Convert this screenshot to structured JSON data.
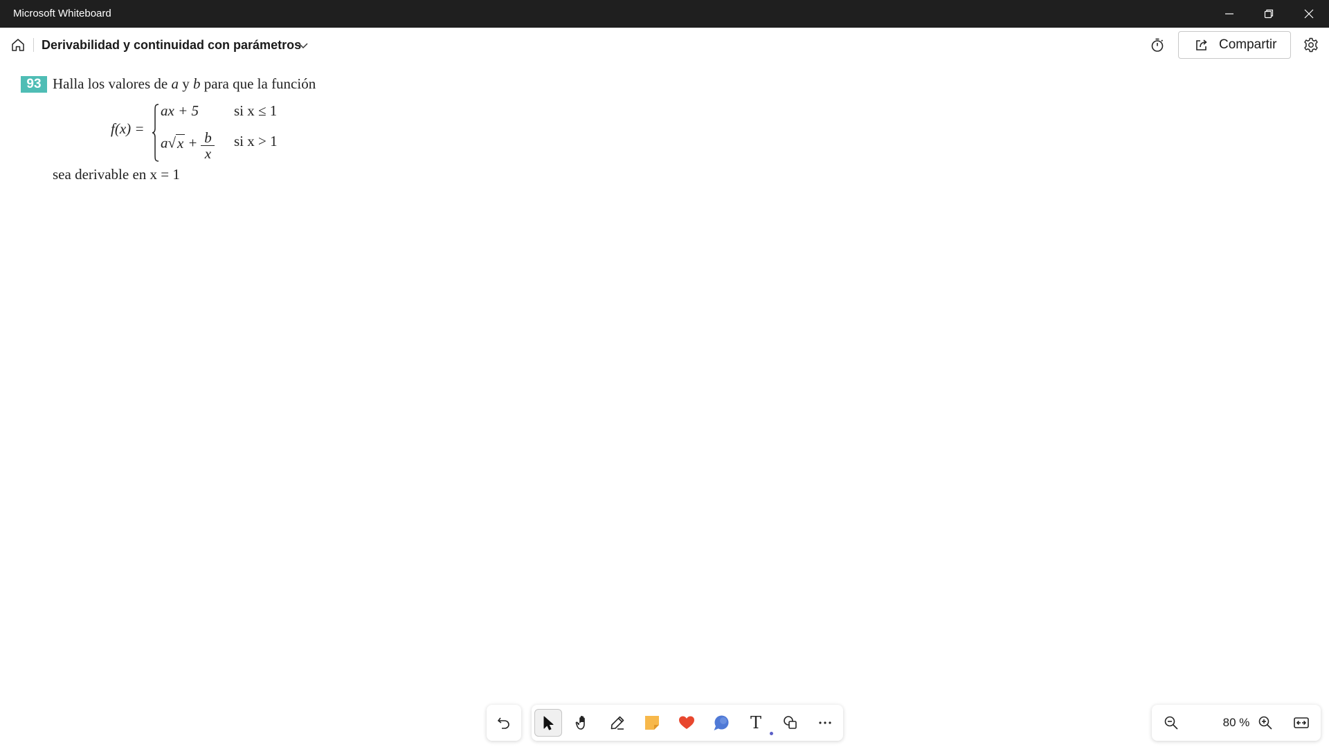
{
  "window": {
    "title": "Microsoft Whiteboard",
    "controls": [
      "minimize",
      "restore",
      "close"
    ]
  },
  "header": {
    "board_title": "Derivabilidad y continuidad con parámetros",
    "share_label": "Compartir"
  },
  "canvas": {
    "exercise": {
      "number": "93",
      "prompt_a": "Halla los valores de ",
      "var_a": "a",
      "prompt_y": " y ",
      "var_b": "b",
      "prompt_b": " para que la función",
      "fx": "f(x) =",
      "case1_expr": "ax + 5",
      "case1_cond": "si x ≤ 1",
      "case2_a": "a",
      "case2_sqrt_sign": "√",
      "case2_sqrt_arg": "x",
      "case2_plus": "+",
      "case2_num": "b",
      "case2_den": "x",
      "case2_cond": "si x > 1",
      "tail": "sea derivable en x = 1"
    }
  },
  "toolbar": {
    "tools": [
      {
        "name": "select",
        "icon": "select-arrow-icon",
        "active": true
      },
      {
        "name": "hand",
        "icon": "hand-icon"
      },
      {
        "name": "pen",
        "icon": "pen-icon"
      },
      {
        "name": "sticky-note",
        "icon": "sticky-note-icon"
      },
      {
        "name": "reactions",
        "icon": "heart-icon"
      },
      {
        "name": "comment",
        "icon": "comment-icon"
      },
      {
        "name": "text",
        "icon": "text-icon",
        "glyph": "T"
      },
      {
        "name": "shapes",
        "icon": "shapes-icon"
      },
      {
        "name": "more",
        "icon": "more-icon"
      }
    ],
    "colors": {
      "sticky": "#f7b84b",
      "heart": "#e8472e",
      "comment": "#4f79d6",
      "dot": "#5b5fc7"
    }
  },
  "zoom": {
    "level": "80 %"
  }
}
